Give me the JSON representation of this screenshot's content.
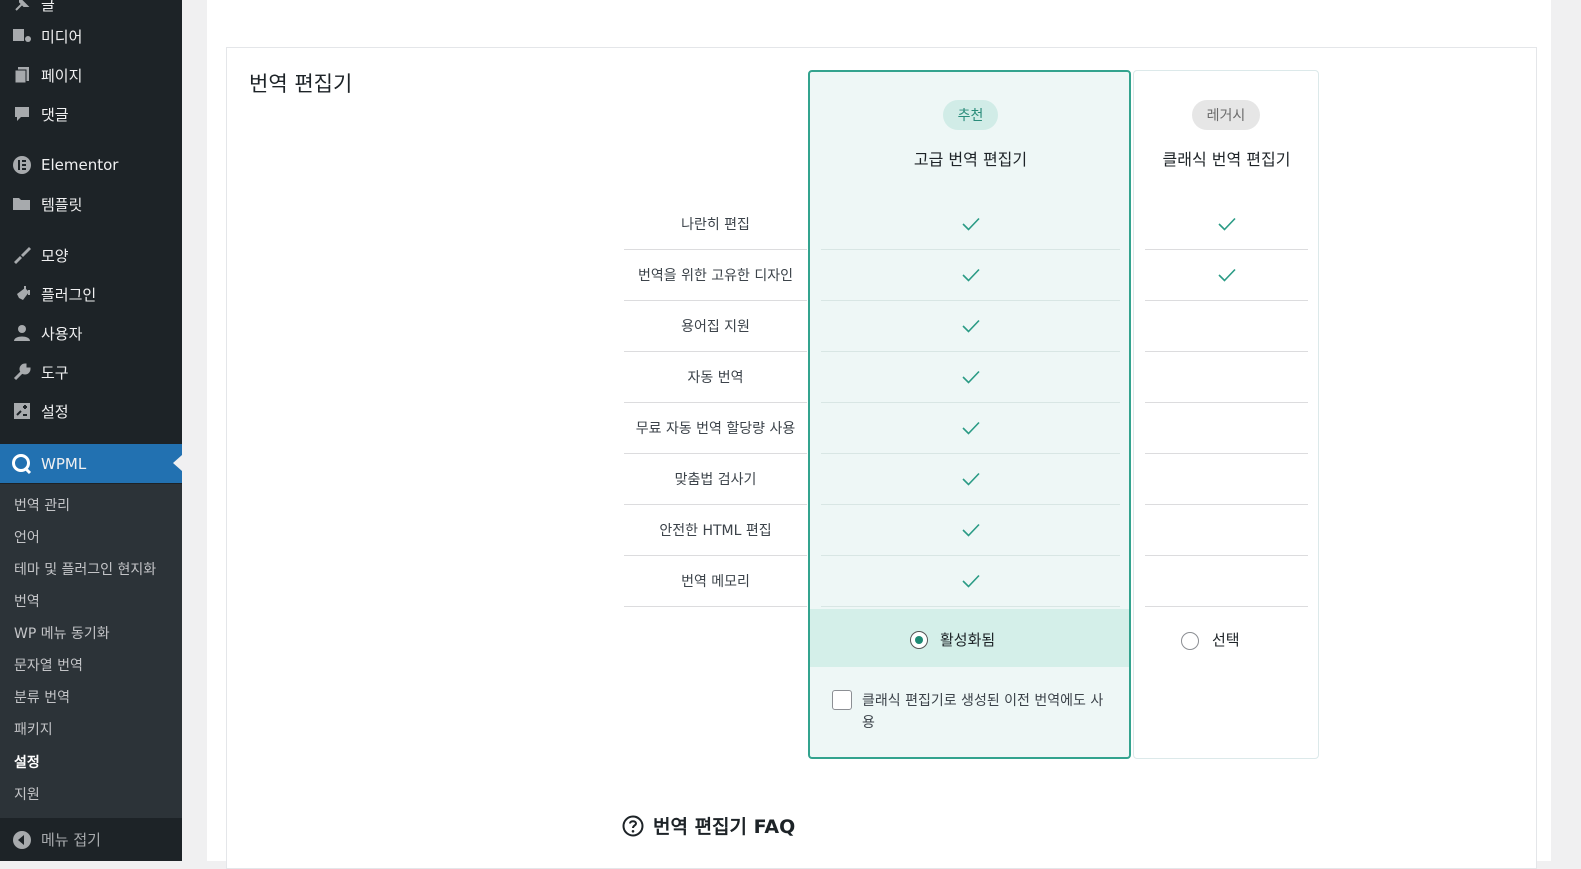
{
  "sidebar": {
    "items": [
      {
        "icon": "pin-icon",
        "label": "글"
      },
      {
        "icon": "media-icon",
        "label": "미디어"
      },
      {
        "icon": "page-icon",
        "label": "페이지"
      },
      {
        "icon": "comment-icon",
        "label": "댓글"
      },
      {
        "icon": "elementor-icon",
        "label": "Elementor"
      },
      {
        "icon": "folder-icon",
        "label": "템플릿"
      },
      {
        "icon": "brush-icon",
        "label": "모양"
      },
      {
        "icon": "plugin-icon",
        "label": "플러그인"
      },
      {
        "icon": "user-icon",
        "label": "사용자"
      },
      {
        "icon": "wrench-icon",
        "label": "도구"
      },
      {
        "icon": "settings-icon",
        "label": "설정"
      }
    ],
    "active": {
      "icon": "wpml-icon",
      "label": "WPML"
    },
    "submenu": [
      "번역 관리",
      "언어",
      "테마 및 플러그인 현지화",
      "번역",
      "WP 메뉴 동기화",
      "문자열 번역",
      "분류 번역",
      "패키지",
      "설정",
      "지원"
    ],
    "collapse_label": "메뉴 접기"
  },
  "main": {
    "section_title": "번역 편집기",
    "features": [
      "나란히 편집",
      "번역을 위한 고유한 디자인",
      "용어집 지원",
      "자동 번역",
      "무료 자동 번역 할당량 사용",
      "맞춤법 검사기",
      "안전한 HTML 편집",
      "번역 메모리"
    ],
    "advanced": {
      "badge": "추천",
      "title": "고급 번역 편집기",
      "checks": [
        true,
        true,
        true,
        true,
        true,
        true,
        true,
        true
      ],
      "status_label": "활성화됨",
      "checkbox_label": "클래식 편집기로 생성된 이전 번역에도 사용"
    },
    "classic": {
      "badge": "레거시",
      "title": "클래식 번역 편집기",
      "checks": [
        true,
        true,
        false,
        false,
        false,
        false,
        false,
        false
      ],
      "select_label": "선택"
    },
    "faq_title": "번역 편집기 FAQ",
    "accent_color": "#33a38e"
  }
}
